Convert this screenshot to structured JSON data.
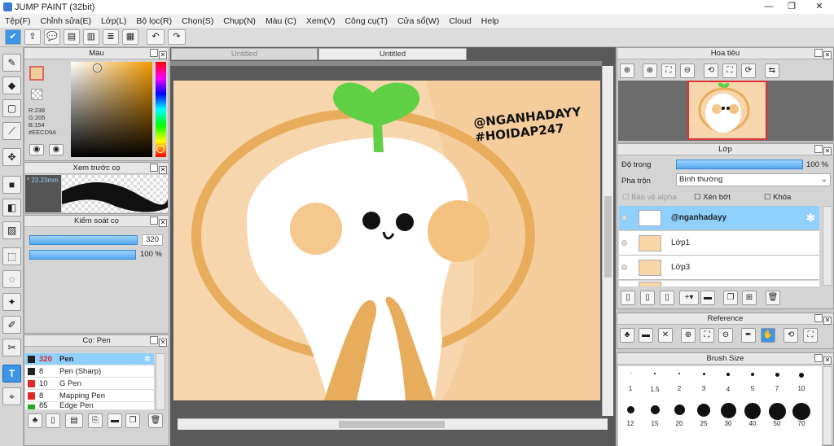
{
  "app": {
    "title": "JUMP PAINT (32bit)"
  },
  "window_controls": {
    "minimize": "—",
    "restore": "❐",
    "close": "✕"
  },
  "menu": [
    "Tệp(F)",
    "Chỉnh sửa(E)",
    "Lớp(L)",
    "Bộ lọc(R)",
    "Chọn(S)",
    "Chụp(N)",
    "Màu (C)",
    "Xem(V)",
    "Công cụ(T)",
    "Cửa sổ(W)",
    "Cloud",
    "Help"
  ],
  "toolbar_icons": [
    "check-icon",
    "export-icon",
    "speech-icon",
    "message-icon",
    "document-icon",
    "list-icon",
    "grid-icon",
    "undo-icon",
    "redo-icon"
  ],
  "color_panel": {
    "title": "Màu",
    "r": "R:238",
    "g": "G:205",
    "b": "B:154",
    "hex": "#EECD9A",
    "fg_color": "#EECD9A",
    "bg_color": "#ffffff"
  },
  "preview_panel": {
    "title": "Xem trước cọ",
    "size": "23.23mm"
  },
  "brush_control": {
    "title": "Kiểm soát cọ",
    "size_value": "320",
    "opacity_value": "100 %"
  },
  "brush_list": {
    "title": "Cọ: Pen",
    "items": [
      {
        "size": "320",
        "name": "Pen",
        "color": "#222222",
        "selected": true
      },
      {
        "size": "8",
        "name": "Pen (Sharp)",
        "color": "#222222",
        "selected": false
      },
      {
        "size": "10",
        "name": "G Pen",
        "color": "#e02a2a",
        "selected": false
      },
      {
        "size": "8",
        "name": "Mapping Pen",
        "color": "#e02a2a",
        "selected": false
      },
      {
        "size": "85",
        "name": "Edge Pen",
        "color": "#22aa22",
        "selected": false
      }
    ]
  },
  "tabs": [
    {
      "label": "Untitled",
      "active": false
    },
    {
      "label": "Untitled",
      "active": true
    }
  ],
  "canvas": {
    "watermark_line1": "@NGANHADAYY",
    "watermark_line2": "#HOIDAP247"
  },
  "navigator": {
    "title": "Hoa tiêu"
  },
  "layer_panel": {
    "title": "Lớp",
    "opacity_label": "Độ trong",
    "opacity_value": "100 %",
    "blend_label": "Pha trộn",
    "blend_value": "Bình thường",
    "protect_alpha": "Bảo vệ alpha",
    "clipping": "Xén bớt",
    "lock": "Khóa",
    "layers": [
      {
        "name": "@nganhadayy",
        "selected": true
      },
      {
        "name": "Lớp1",
        "selected": false
      },
      {
        "name": "Lớp3",
        "selected": false
      }
    ]
  },
  "reference_panel": {
    "title": "Reference"
  },
  "brush_size_panel": {
    "title": "Brush Size",
    "row1": [
      "1",
      "1.5",
      "2",
      "3",
      "4",
      "5",
      "7",
      "10"
    ],
    "row2": [
      "12",
      "15",
      "20",
      "25",
      "30",
      "40",
      "50",
      "70"
    ]
  }
}
